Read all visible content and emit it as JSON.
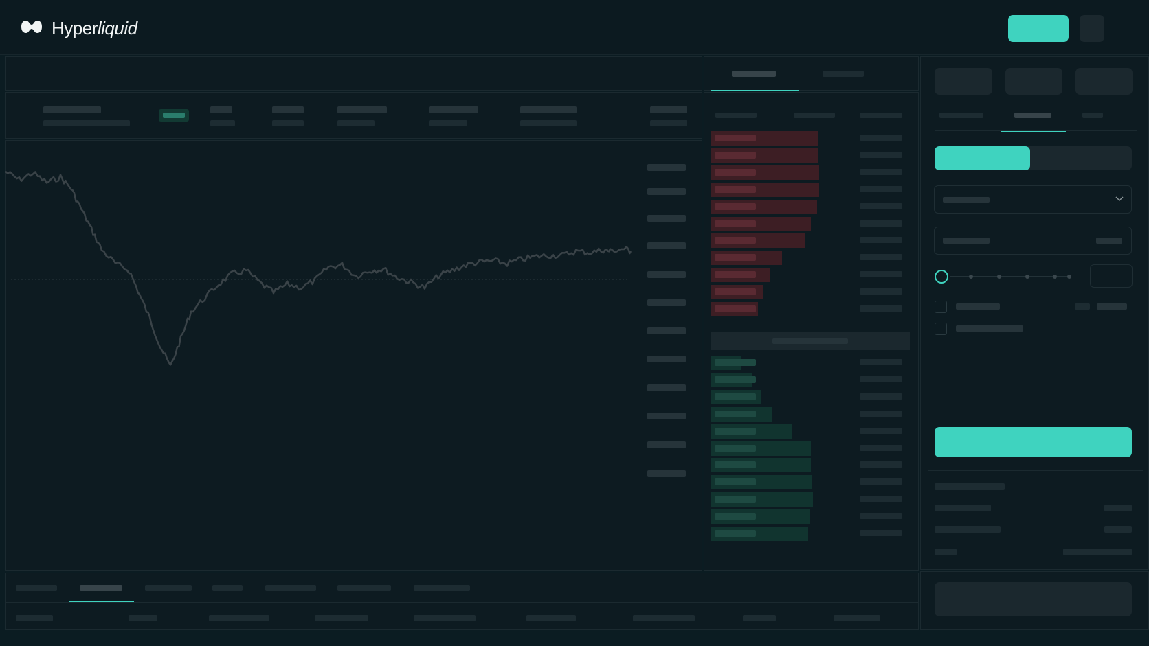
{
  "header": {
    "brand_main": "Hyper",
    "brand_italic": "liquid",
    "logo_icon": "hyperliquid-logo-icon",
    "connect_button_icon": "",
    "settings_icon": "settings-icon"
  },
  "colors": {
    "accent": "#3fd3bf",
    "background": "#0b1c22",
    "ask": "#3d1e24",
    "bid": "#11342f",
    "price_line": "#3a4348"
  },
  "chart": {
    "series_color": "#3a4348",
    "reference_line": "dashed"
  },
  "orderbook": {
    "ask_depth": [
      0.86,
      0.86,
      0.87,
      0.87,
      0.85,
      0.8,
      0.75,
      0.57,
      0.47,
      0.42,
      0.38
    ],
    "bid_depth": [
      0.24,
      0.33,
      0.4,
      0.49,
      0.65,
      0.8,
      0.8,
      0.81,
      0.82,
      0.79,
      0.78
    ]
  },
  "order_form": {
    "order_tabs_active_index": 1,
    "side_active": "buy",
    "leverage_slider": 0,
    "dropdown_icon": "chevron-down-icon"
  },
  "bottom_tabs": {
    "active_index": 1
  }
}
